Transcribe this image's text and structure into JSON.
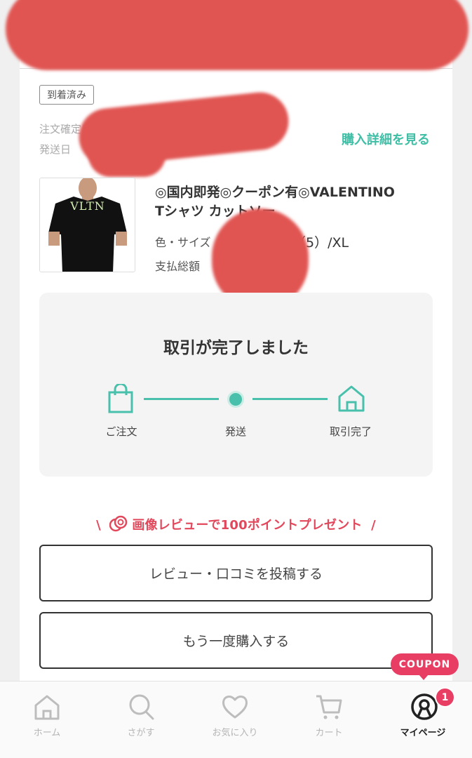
{
  "order": {
    "status_badge": "到着済み",
    "order_date_label": "注文確定日",
    "ship_date_label": "発送日",
    "detail_link": "購入詳細を見る"
  },
  "product": {
    "title_line1": "◎国内即発◎クーポン有◎VALENTINO",
    "title_line2": "Tシャツ カットソー",
    "thumb_text": "VLTN",
    "color_size_label": "色・サイズ",
    "size_value": "（5）/XL",
    "total_label": "支払総額"
  },
  "progress": {
    "title": "取引が完了しました",
    "steps": [
      {
        "label": "ご注文",
        "icon": "shopping-bag-icon"
      },
      {
        "label": "発送",
        "icon": "progress-dot-icon"
      },
      {
        "label": "取引完了",
        "icon": "home-icon"
      }
    ]
  },
  "promo": {
    "text": "画像レビューで100ポイントプレゼント",
    "slash_left": "\\",
    "slash_right": "/",
    "icon": "coins-icon",
    "color": "#e2485c"
  },
  "buttons": {
    "review": "レビュー・口コミを投稿する",
    "rebuy": "もう一度購入する"
  },
  "coupon_tag": "COUPON",
  "nav": {
    "items": [
      {
        "label": "ホーム",
        "icon": "home-icon"
      },
      {
        "label": "さがす",
        "icon": "search-icon"
      },
      {
        "label": "お気に入り",
        "icon": "heart-icon"
      },
      {
        "label": "カート",
        "icon": "cart-icon"
      },
      {
        "label": "マイページ",
        "icon": "user-icon"
      }
    ],
    "badge_count": "1"
  },
  "colors": {
    "accent": "#49c0ab",
    "link": "#3fbfa6",
    "pink": "#e83e64",
    "redaction": "#e05552"
  }
}
